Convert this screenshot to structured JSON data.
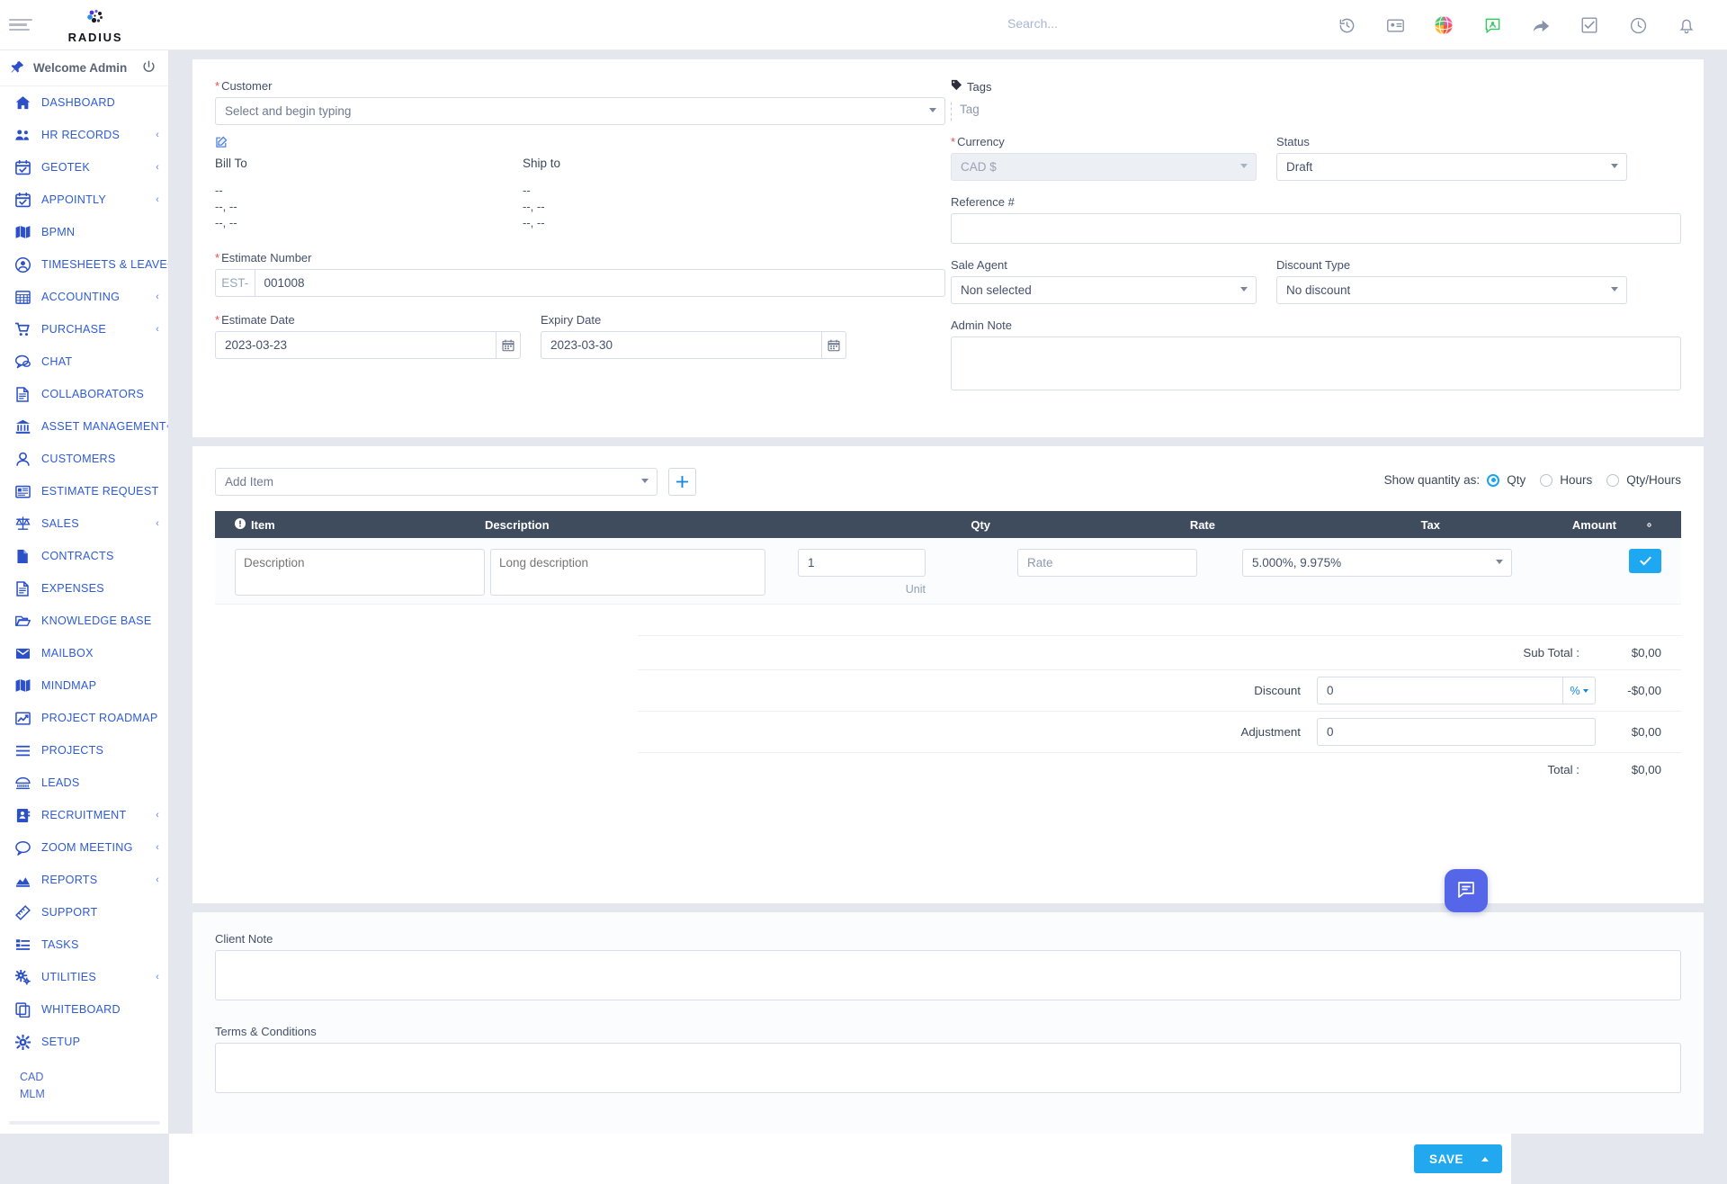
{
  "topbar": {
    "brand": "RADIUS",
    "search_placeholder": "Search...",
    "icons": [
      {
        "name": "history-icon",
        "label": "History"
      },
      {
        "name": "id-card-icon",
        "label": "Contacts"
      },
      {
        "name": "globe-colored-icon",
        "label": "Translate"
      },
      {
        "name": "chat-user-icon",
        "label": "Messages"
      },
      {
        "name": "share-arrow-icon",
        "label": "Share"
      },
      {
        "name": "checkbox-icon",
        "label": "Todo"
      },
      {
        "name": "clock-icon",
        "label": "Timer"
      },
      {
        "name": "bell-icon",
        "label": "Notifications"
      }
    ]
  },
  "sidebar": {
    "welcome": "Welcome Admin",
    "items": [
      {
        "label": "DASHBOARD",
        "icon": "home-icon",
        "caret": false
      },
      {
        "label": "HR RECORDS",
        "icon": "users-icon",
        "caret": true
      },
      {
        "label": "GEOTEK",
        "icon": "calendar-check-icon",
        "caret": true
      },
      {
        "label": "APPOINTLY",
        "icon": "calendar-check-icon",
        "caret": true
      },
      {
        "label": "BPMN",
        "icon": "map-icon",
        "caret": false
      },
      {
        "label": "TIMESHEETS & LEAVE",
        "icon": "user-circle-icon",
        "caret": true
      },
      {
        "label": "ACCOUNTING",
        "icon": "table-icon",
        "caret": true
      },
      {
        "label": "PURCHASE",
        "icon": "cart-icon",
        "caret": true
      },
      {
        "label": "CHAT",
        "icon": "chat-icon",
        "caret": false
      },
      {
        "label": "COLLABORATORS",
        "icon": "document-icon",
        "caret": false
      },
      {
        "label": "ASSET MANAGEMENT",
        "icon": "bank-icon",
        "caret": true
      },
      {
        "label": "CUSTOMERS",
        "icon": "user-icon",
        "caret": false
      },
      {
        "label": "ESTIMATE REQUEST",
        "icon": "list-box-icon",
        "caret": false
      },
      {
        "label": "SALES",
        "icon": "scales-icon",
        "caret": true
      },
      {
        "label": "CONTRACTS",
        "icon": "file-icon",
        "caret": false
      },
      {
        "label": "EXPENSES",
        "icon": "document-icon",
        "caret": false
      },
      {
        "label": "KNOWLEDGE BASE",
        "icon": "folder-open-icon",
        "caret": false
      },
      {
        "label": "MAILBOX",
        "icon": "envelope-icon",
        "caret": false
      },
      {
        "label": "MINDMAP",
        "icon": "map-icon",
        "caret": false
      },
      {
        "label": "PROJECT ROADMAP",
        "icon": "chart-line-icon",
        "caret": false
      },
      {
        "label": "PROJECTS",
        "icon": "bars-icon",
        "caret": false
      },
      {
        "label": "LEADS",
        "icon": "leads-icon",
        "caret": false
      },
      {
        "label": "RECRUITMENT",
        "icon": "address-book-icon",
        "caret": true
      },
      {
        "label": "ZOOM MEETING",
        "icon": "comment-icon",
        "caret": true
      },
      {
        "label": "REPORTS",
        "icon": "area-chart-icon",
        "caret": true
      },
      {
        "label": "SUPPORT",
        "icon": "ticket-icon",
        "caret": false
      },
      {
        "label": "TASKS",
        "icon": "tasks-icon",
        "caret": false
      },
      {
        "label": "UTILITIES",
        "icon": "cogs-icon",
        "caret": true
      },
      {
        "label": "WHITEBOARD",
        "icon": "copy-icon",
        "caret": false
      },
      {
        "label": "SETUP",
        "icon": "gear-icon",
        "caret": false
      }
    ],
    "footer": [
      "CAD",
      "MLM"
    ]
  },
  "estimate": {
    "customer_label": "Customer",
    "customer_placeholder": "Select and begin typing",
    "bill_to_label": "Bill To",
    "ship_to_label": "Ship to",
    "bill_to_lines": [
      "--",
      "--, --",
      "--, --"
    ],
    "ship_to_lines": [
      "--",
      "--, --",
      "--, --"
    ],
    "estimate_number_label": "Estimate Number",
    "estimate_number_prefix": "EST-",
    "estimate_number_value": "001008",
    "estimate_date_label": "Estimate Date",
    "estimate_date_value": "2023-03-23",
    "expiry_date_label": "Expiry Date",
    "expiry_date_value": "2023-03-30",
    "tags_label": "Tags",
    "tags_placeholder": "Tag",
    "currency_label": "Currency",
    "currency_value": "CAD $",
    "status_label": "Status",
    "status_value": "Draft",
    "reference_label": "Reference #",
    "reference_value": "",
    "sale_agent_label": "Sale Agent",
    "sale_agent_value": "Non selected",
    "discount_type_label": "Discount Type",
    "discount_type_value": "No discount",
    "admin_note_label": "Admin Note",
    "admin_note_value": ""
  },
  "items": {
    "add_item_placeholder": "Add Item",
    "add_button": "+",
    "quantity_mode_label": "Show quantity as:",
    "quantity_modes": [
      {
        "label": "Qty",
        "selected": true
      },
      {
        "label": "Hours",
        "selected": false
      },
      {
        "label": "Qty/Hours",
        "selected": false
      }
    ],
    "columns": [
      "Item",
      "Description",
      "Qty",
      "Rate",
      "Tax",
      "Amount"
    ],
    "row": {
      "description_placeholder": "Description",
      "long_description_placeholder": "Long description",
      "qty_value": "1",
      "unit_label": "Unit",
      "rate_placeholder": "Rate",
      "tax_value": "5.000%, 9.975%",
      "confirm_label": "✔"
    }
  },
  "totals": {
    "sub_total_label": "Sub Total :",
    "sub_total_value": "$0,00",
    "discount_label": "Discount",
    "discount_value": "0",
    "discount_unit": "%",
    "discount_amount": "-$0,00",
    "adjustment_label": "Adjustment",
    "adjustment_value": "0",
    "adjustment_amount": "$0,00",
    "total_label": "Total :",
    "total_value": "$0,00"
  },
  "notes": {
    "client_note_label": "Client Note",
    "client_note_value": "",
    "terms_label": "Terms & Conditions",
    "terms_value": ""
  },
  "footer": {
    "save_label": "SAVE"
  }
}
